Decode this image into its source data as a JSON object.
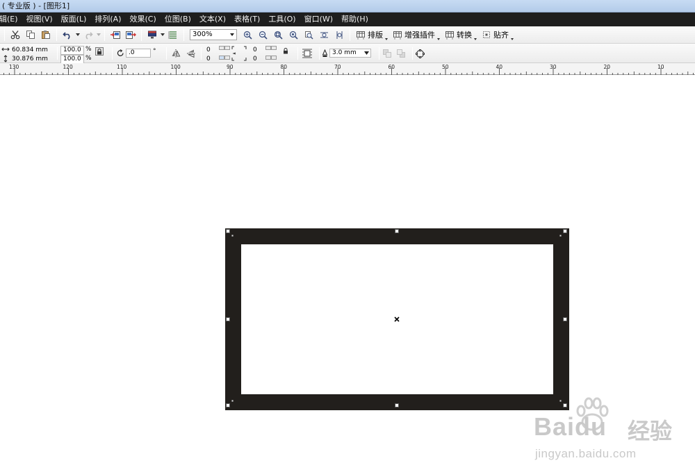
{
  "window": {
    "title": "( 专业版 ) - [图形1]"
  },
  "menu": {
    "items": [
      {
        "label": "编辑(E)",
        "id": "edit"
      },
      {
        "label": "视图(V)",
        "id": "view"
      },
      {
        "label": "版面(L)",
        "id": "layout"
      },
      {
        "label": "排列(A)",
        "id": "arrange"
      },
      {
        "label": "效果(C)",
        "id": "effects"
      },
      {
        "label": "位图(B)",
        "id": "bitmaps"
      },
      {
        "label": "文本(X)",
        "id": "text"
      },
      {
        "label": "表格(T)",
        "id": "table"
      },
      {
        "label": "工具(O)",
        "id": "tools"
      },
      {
        "label": "窗口(W)",
        "id": "window"
      },
      {
        "label": "帮助(H)",
        "id": "help"
      }
    ]
  },
  "toolbar": {
    "zoom_level": "300%",
    "buttons": {
      "imposition": "排版",
      "enhance_plugin": "增强插件",
      "convert": "转换",
      "snap": "贴齐"
    }
  },
  "property_bar": {
    "width": "60.834 mm",
    "height": "30.876 mm",
    "scale_x": "100.0",
    "scale_y": "100.0",
    "scale_unit": "%",
    "rotation": ".0",
    "rotation_unit": "°",
    "corner_tl": "0",
    "corner_bl": "0",
    "corner_tr": "0",
    "corner_br": "0",
    "outline_width": "3.0 mm"
  },
  "ruler": {
    "labels": [
      "130",
      "120",
      "110",
      "100",
      "90",
      "80",
      "70",
      "60",
      "50",
      "40",
      "30",
      "20",
      "10"
    ]
  },
  "watermark": {
    "brand": "Baidu",
    "chinese": "经验",
    "url": "jingyan.baidu.com"
  },
  "colors": {
    "menu_bg": "#1e1e1e",
    "title_bar": "#c7dbf3",
    "shape_fill": "#221f1c",
    "canvas": "#ffffff"
  }
}
